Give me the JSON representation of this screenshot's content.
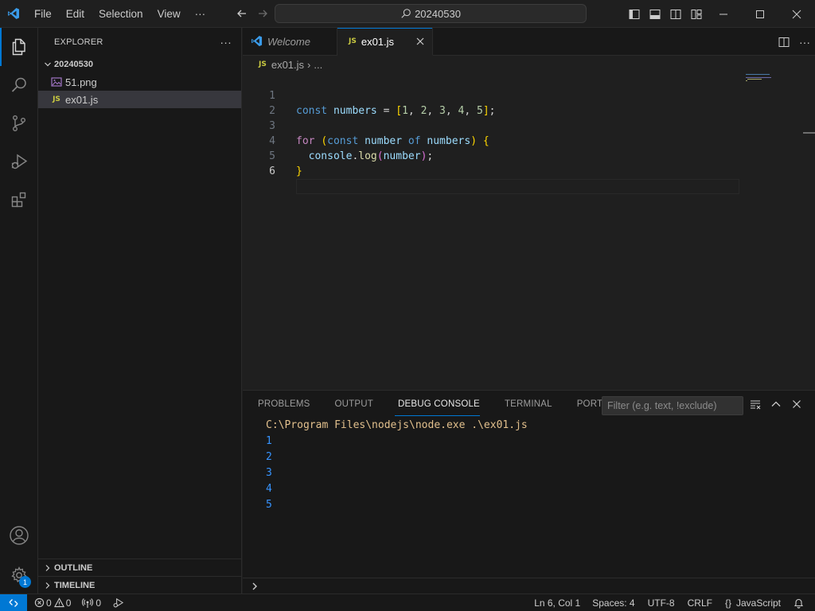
{
  "titlebar": {
    "menu": [
      "File",
      "Edit",
      "Selection",
      "View"
    ],
    "more": "···",
    "search_text": "20240530"
  },
  "activity_bar": {
    "items": [
      "explorer-icon",
      "search-icon",
      "source-control-icon",
      "run-debug-icon",
      "extensions-icon"
    ],
    "bottom": [
      "accounts-icon",
      "manage-gear-icon"
    ],
    "manage_badge": "1"
  },
  "sidebar": {
    "title": "EXPLORER",
    "more": "···",
    "folder": "20240530",
    "files": [
      {
        "name": "51.png",
        "type": "image"
      },
      {
        "name": "ex01.js",
        "type": "js",
        "selected": true
      }
    ],
    "outline": "OUTLINE",
    "timeline": "TIMELINE"
  },
  "tabs": [
    {
      "label": "Welcome",
      "active": false
    },
    {
      "label": "ex01.js",
      "active": true
    }
  ],
  "js_badge": "JS",
  "breadcrumb": {
    "file": "ex01.js",
    "sep": "›",
    "rest": "..."
  },
  "editor": {
    "line_numbers": [
      "1",
      "2",
      "3",
      "4",
      "5",
      "6"
    ],
    "current_line": 6
  },
  "panel": {
    "tabs": [
      "PROBLEMS",
      "OUTPUT",
      "DEBUG CONSOLE",
      "TERMINAL",
      "PORTS"
    ],
    "active_tab": "DEBUG CONSOLE",
    "filter_placeholder": "Filter (e.g. text, !exclude)",
    "command": "C:\\Program Files\\nodejs\\node.exe .\\ex01.js",
    "output": [
      "1",
      "2",
      "3",
      "4",
      "5"
    ]
  },
  "statusbar": {
    "errors": "0",
    "warnings": "0",
    "ports": "0",
    "position": "Ln 6, Col 1",
    "spaces": "Spaces: 4",
    "encoding": "UTF-8",
    "eol": "CRLF",
    "braces": "{}",
    "language": "JavaScript"
  },
  "colors": {
    "accent": "#0078d4",
    "js_yellow": "#cbcb41",
    "console_cmd": "#e2c08d",
    "console_out": "#3794ff"
  }
}
